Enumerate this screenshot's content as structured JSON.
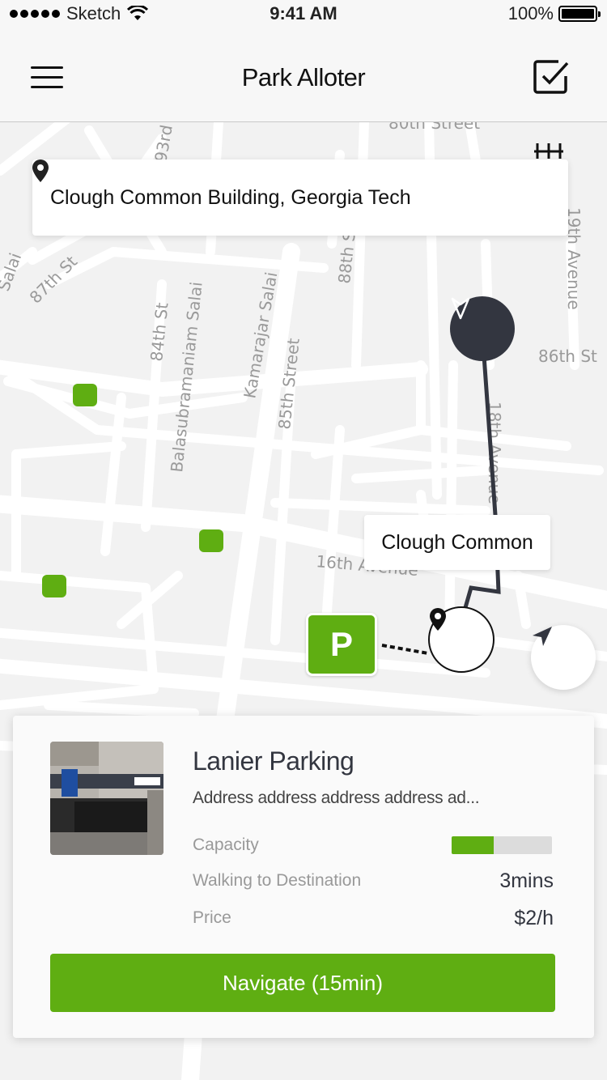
{
  "status_bar": {
    "carrier": "Sketch",
    "time": "9:41 AM",
    "battery": "100%"
  },
  "nav": {
    "title": "Park Alloter",
    "menu_icon": "hamburger-menu-icon",
    "action_icon": "checkbox-icon"
  },
  "search": {
    "location": "Clough Common Building, Georgia Tech",
    "icon": "map-pin-icon"
  },
  "map": {
    "streets": [
      "80th Street",
      "93rd",
      "87th St",
      "Salai",
      "84th St",
      "Balasubramaniam Salai",
      "Kamarajar Salai",
      "85th Street",
      "88th S",
      "19th Avenue",
      "86th St",
      "18th Avenue",
      "16th Avenue"
    ],
    "destination_label": "Clough Common",
    "parking_marker_label": "P"
  },
  "card": {
    "name": "Lanier Parking",
    "address": "Address address address address ad...",
    "capacity_label": "Capacity",
    "capacity_fill": 0.42,
    "walking_label": "Walking to Destination",
    "walking_value": "3mins",
    "price_label": "Price",
    "price_value": "$2/h",
    "navigate_label": "Navigate (15min)"
  },
  "colors": {
    "accent": "#5fae12",
    "dark": "#333640",
    "map_bg": "#f2f2f2"
  }
}
